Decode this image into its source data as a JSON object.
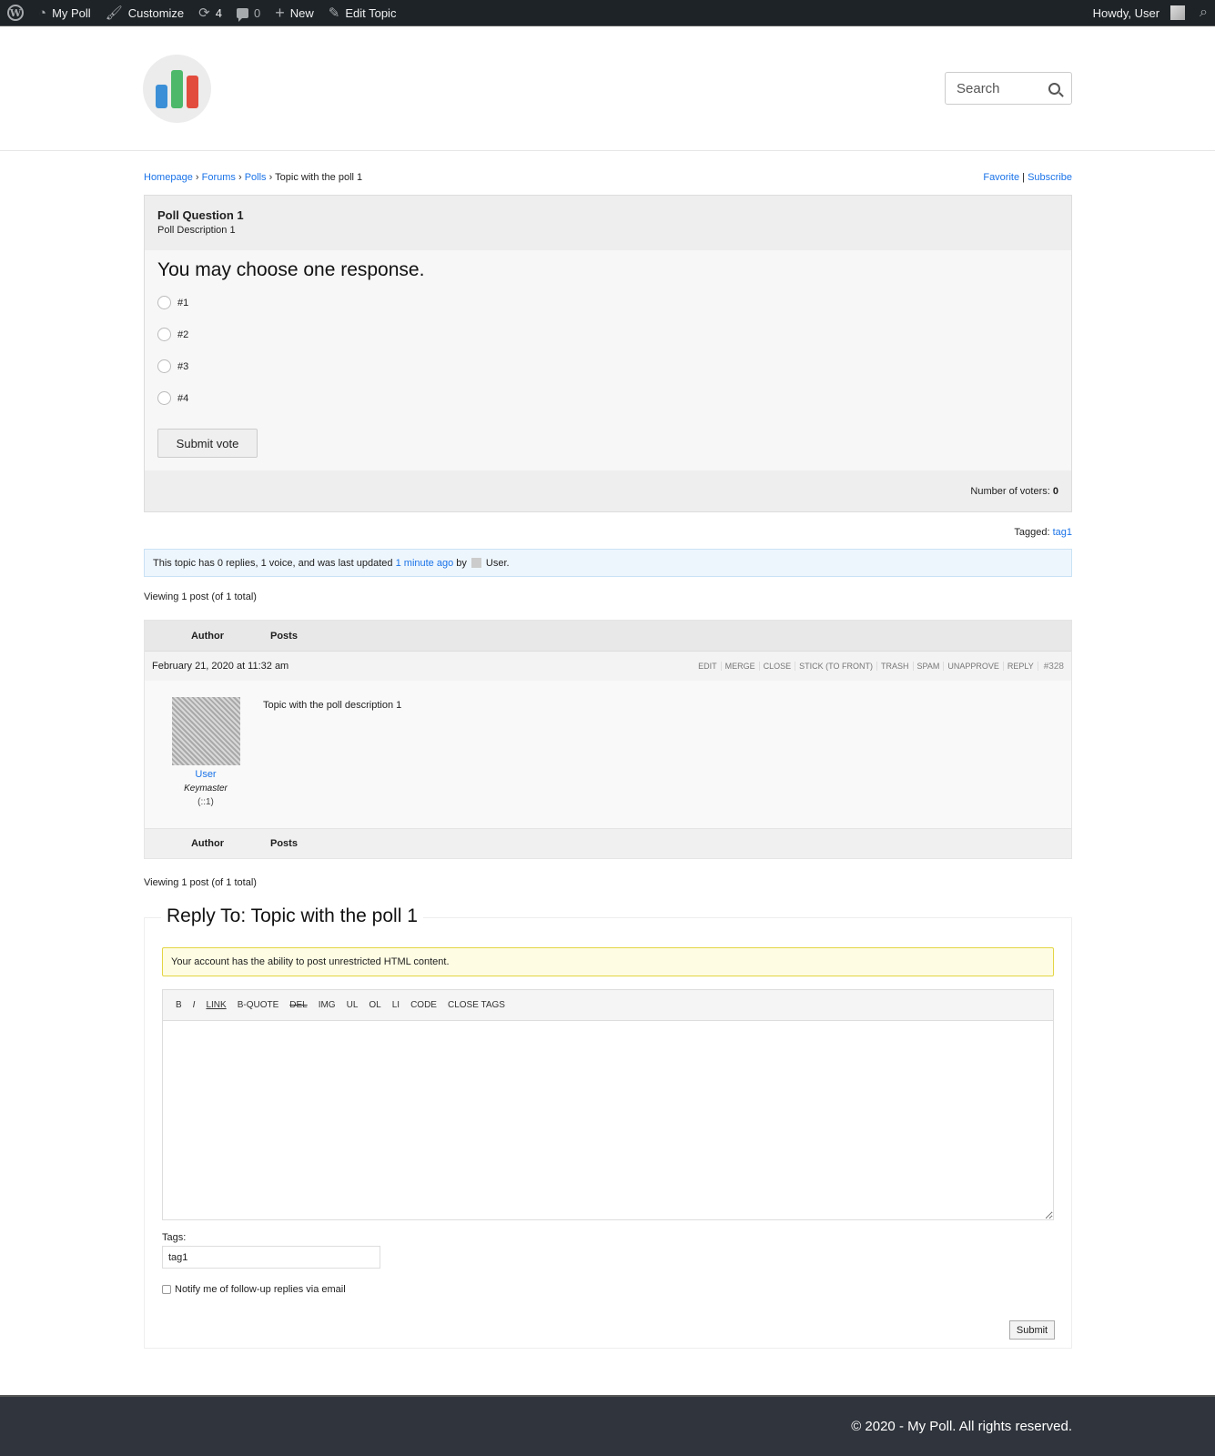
{
  "adminbar": {
    "site_name": "My Poll",
    "customize": "Customize",
    "updates_count": "4",
    "comments_count": "0",
    "new_label": "New",
    "edit_label": "Edit Topic",
    "howdy": "Howdy, User"
  },
  "header": {
    "logo_colors": [
      "#3b8fd6",
      "#4db86a",
      "#e24c3d"
    ],
    "search_placeholder": "Search"
  },
  "breadcrumb": {
    "items": [
      "Homepage",
      "Forums",
      "Polls"
    ],
    "current": "Topic with the poll 1",
    "separator": "›"
  },
  "topic_actions": {
    "favorite": "Favorite",
    "subscribe": "Subscribe",
    "divider": "|"
  },
  "poll": {
    "question": "Poll Question 1",
    "description": "Poll Description 1",
    "instruction": "You may choose one response.",
    "options": [
      "#1",
      "#2",
      "#3",
      "#4"
    ],
    "submit_label": "Submit vote",
    "voters_label": "Number of voters:",
    "voters_count": "0"
  },
  "tags": {
    "label": "Tagged:",
    "values": [
      "tag1"
    ]
  },
  "topic_info": {
    "text_before": "This topic has 0 replies, 1 voice, and was last updated",
    "freshness": "1 minute ago",
    "by": "by",
    "user": "User."
  },
  "viewing": "Viewing 1 post (of 1 total)",
  "posts_table": {
    "col_author": "Author",
    "col_posts": "Posts",
    "post": {
      "date": "February 21, 2020 at 11:32 am",
      "admin_links": [
        "EDIT",
        "MERGE",
        "CLOSE",
        "STICK (TO FRONT)",
        "TRASH",
        "SPAM",
        "UNAPPROVE",
        "REPLY"
      ],
      "id": "#328",
      "author_name": "User",
      "author_role": "Keymaster",
      "author_ip": "(::1)",
      "content": "Topic with the poll description 1"
    }
  },
  "reply": {
    "legend": "Reply To: Topic with the poll 1",
    "notice": "Your account has the ability to post unrestricted HTML content.",
    "quicktags": [
      "B",
      "I",
      "LINK",
      "B-QUOTE",
      "DEL",
      "IMG",
      "UL",
      "OL",
      "LI",
      "CODE",
      "CLOSE TAGS"
    ],
    "tags_label": "Tags:",
    "tags_value": "tag1",
    "notify_label": "Notify me of follow-up replies via email",
    "submit_label": "Submit"
  },
  "footer": {
    "copyright": "© 2020 - My Poll. All rights reserved."
  }
}
